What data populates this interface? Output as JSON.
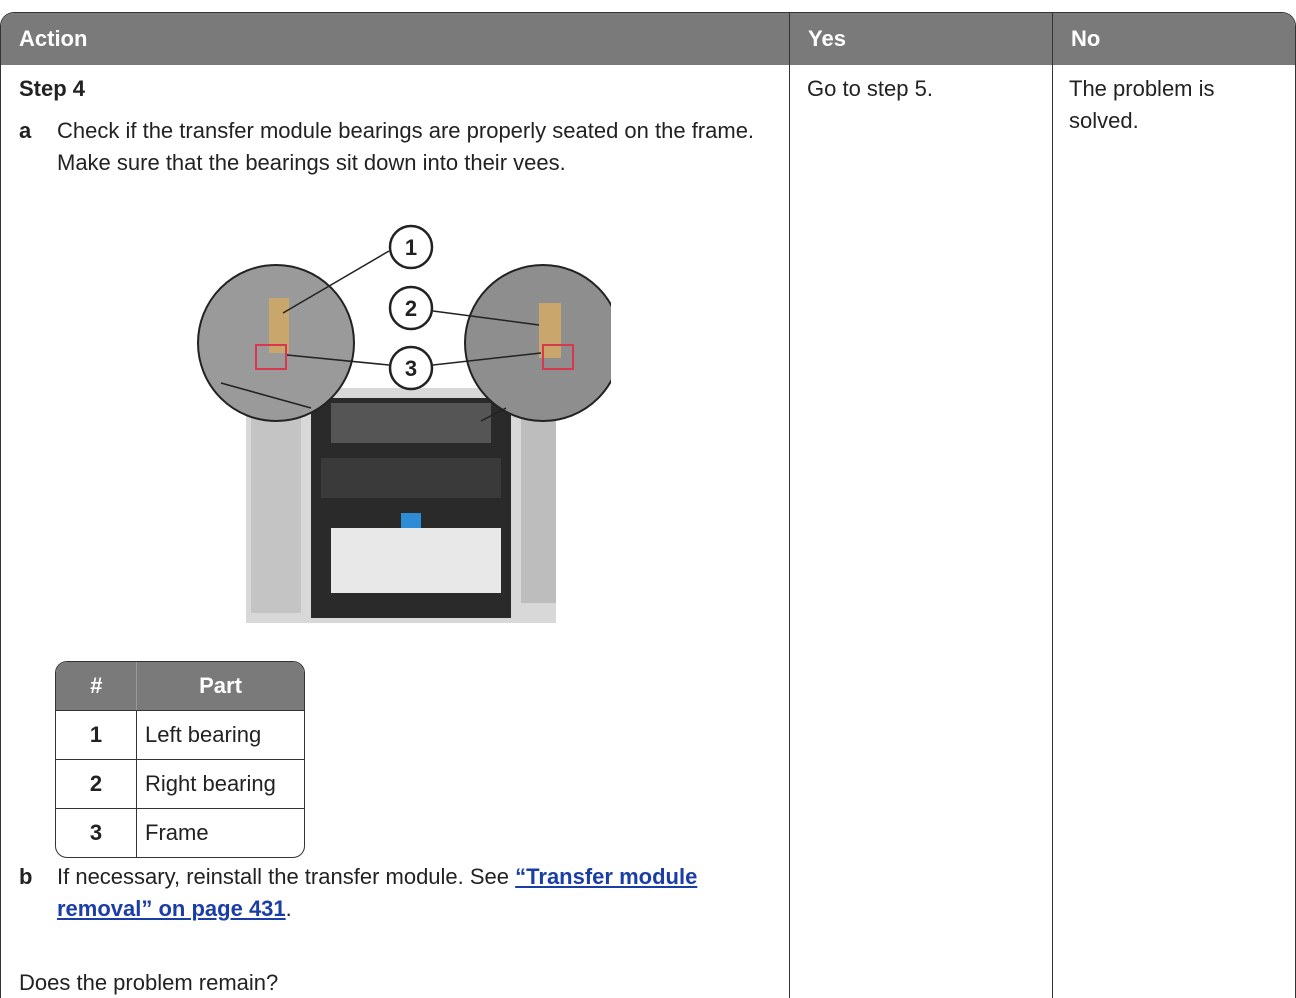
{
  "table": {
    "headers": [
      "Action",
      "Yes",
      "No"
    ],
    "step_title": "Step 4",
    "item_a": {
      "marker": "a",
      "text": "Check if the transfer module bearings are properly seated on the frame. Make sure that the bearings sit down into their vees."
    },
    "figure": {
      "callouts": [
        "1",
        "2",
        "3"
      ]
    },
    "parts_table": {
      "headers": [
        "#",
        "Part"
      ],
      "rows": [
        {
          "num": "1",
          "part": "Left bearing"
        },
        {
          "num": "2",
          "part": "Right bearing"
        },
        {
          "num": "3",
          "part": "Frame"
        }
      ]
    },
    "item_b": {
      "marker": "b",
      "text_before": "If necessary, reinstall the transfer module. See ",
      "link_text": "“Transfer module removal” on page 431",
      "text_after": "."
    },
    "question": "Does the problem remain?",
    "yes_text": "Go to step 5.",
    "no_text": "The problem is solved."
  },
  "colors": {
    "header_bg": "#7a7a7a",
    "link": "#1a3ea5",
    "highlight": "#d9364f"
  }
}
